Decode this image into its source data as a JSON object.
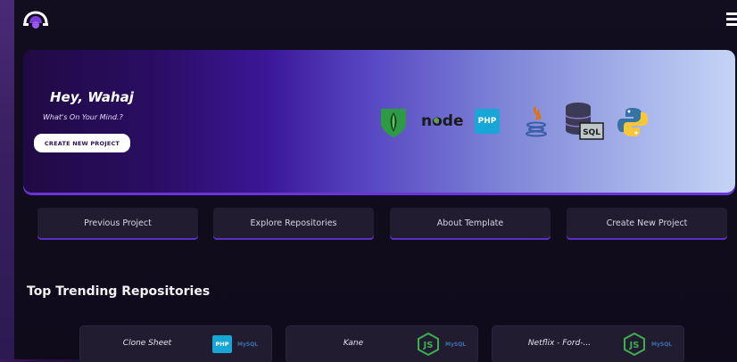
{
  "header": {
    "logo": "cloud-logo-icon",
    "menu": "hamburger-menu-icon"
  },
  "hero": {
    "greeting": "Hey, Wahaj",
    "subtitle": "What's On Your Mind.?",
    "cta_label": "CREATE NEW PROJECT",
    "tech_icons": [
      "mongodb-icon",
      "nodejs-icon",
      "php-icon",
      "java-icon",
      "sql-database-icon",
      "python-icon"
    ],
    "node_text": "node",
    "php_text": "PHP",
    "sql_text": "SQL"
  },
  "actions": [
    {
      "label": "Previous Project"
    },
    {
      "label": "Explore Repositories"
    },
    {
      "label": "About Template"
    },
    {
      "label": "Create New Project"
    }
  ],
  "trending": {
    "title": "Top Trending Repositories",
    "repos": [
      {
        "name": "Clone Sheet",
        "tech": "php-icon",
        "tech_text": "PHP",
        "db": "MySQL"
      },
      {
        "name": "Kane",
        "tech": "nodejs-icon",
        "tech_text": "JS",
        "db": "MySQL"
      },
      {
        "name": "Netflix - Ford-...",
        "tech": "nodejs-icon",
        "tech_text": "JS",
        "db": "MySQL"
      }
    ]
  },
  "colors": {
    "accent": "#5a2fc0",
    "card_bg": "#221c30",
    "page_bg": "#0f0b1b"
  }
}
